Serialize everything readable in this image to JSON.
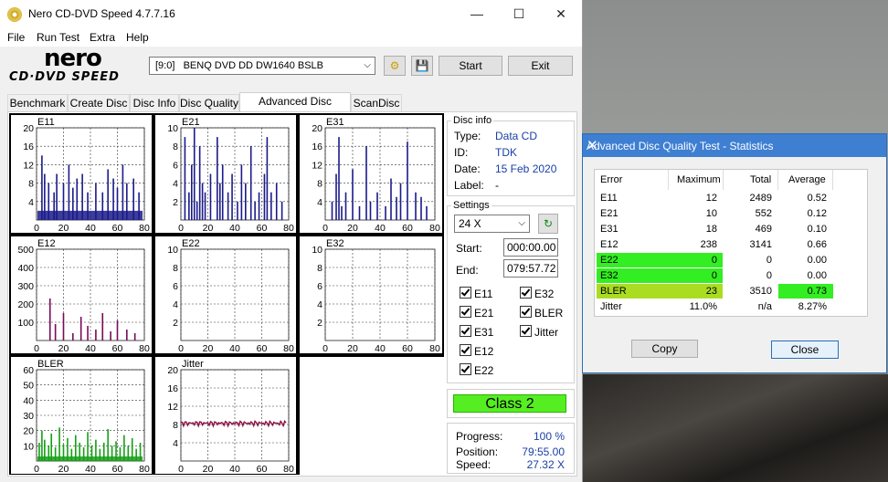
{
  "window": {
    "title": "Nero CD-DVD Speed 4.7.7.16"
  },
  "menu": [
    "File",
    "Run Test",
    "Extra",
    "Help"
  ],
  "logo": {
    "line1": "nero",
    "line2": "CD·DVD SPEED"
  },
  "toolbar": {
    "drive": "[9:0]   BENQ DVD DD DW1640 BSLB",
    "start_label": "Start",
    "exit_label": "Exit"
  },
  "tabs": [
    "Benchmark",
    "Create Disc",
    "Disc Info",
    "Disc Quality",
    "Advanced Disc Quality",
    "ScanDisc"
  ],
  "disc_info": {
    "title": "Disc info",
    "rows": [
      {
        "key": "Type:",
        "value": "Data CD"
      },
      {
        "key": "ID:",
        "value": "TDK"
      },
      {
        "key": "Date:",
        "value": "15 Feb 2020"
      },
      {
        "key": "Label:",
        "value": "-"
      }
    ]
  },
  "settings": {
    "title": "Settings",
    "speed": "24 X",
    "start_label": "Start:",
    "start_value": "000:00.00",
    "end_label": "End:",
    "end_value": "079:57.72",
    "checks_left": [
      "E11",
      "E21",
      "E31",
      "E12",
      "E22"
    ],
    "checks_right": [
      "E32",
      "BLER",
      "Jitter"
    ]
  },
  "class_label": "Class 2",
  "progress": {
    "rows": [
      {
        "key": "Progress:",
        "value": "100 %"
      },
      {
        "key": "Position:",
        "value": "79:55.00"
      },
      {
        "key": "Speed:",
        "value": "27.32 X"
      }
    ]
  },
  "colors": {
    "navy": "#1a1a8a",
    "purple": "#7a0a5a",
    "green": "#13a013",
    "jitter": "#8b1040",
    "class_green": "#55ee22"
  },
  "chart_data": [
    {
      "type": "bar",
      "title": "E11",
      "ylim": [
        0,
        20
      ],
      "yticks": [
        20,
        16,
        12,
        8,
        4
      ],
      "xticks": [
        0,
        20,
        40,
        60,
        80
      ],
      "color": "#1a1a8a",
      "baseline": 2,
      "spikes": [
        [
          4,
          14
        ],
        [
          6,
          10
        ],
        [
          9,
          8
        ],
        [
          13,
          6
        ],
        [
          15,
          10
        ],
        [
          20,
          8
        ],
        [
          24,
          12
        ],
        [
          27,
          7
        ],
        [
          30,
          9
        ],
        [
          34,
          10
        ],
        [
          38,
          6
        ],
        [
          44,
          8
        ],
        [
          49,
          6
        ],
        [
          53,
          11
        ],
        [
          57,
          9
        ],
        [
          60,
          7
        ],
        [
          64,
          12
        ],
        [
          67,
          8
        ],
        [
          72,
          9
        ],
        [
          76,
          6
        ]
      ]
    },
    {
      "type": "bar",
      "title": "E21",
      "ylim": [
        0,
        10
      ],
      "yticks": [
        10,
        8,
        6,
        4,
        2
      ],
      "xticks": [
        0,
        20,
        40,
        60,
        80
      ],
      "color": "#1a1a8a",
      "baseline": 0,
      "spikes": [
        [
          3,
          9
        ],
        [
          6,
          3
        ],
        [
          8,
          6
        ],
        [
          10,
          10
        ],
        [
          12,
          2
        ],
        [
          14,
          8
        ],
        [
          16,
          4
        ],
        [
          18,
          3
        ],
        [
          22,
          5
        ],
        [
          27,
          9
        ],
        [
          29,
          4
        ],
        [
          31,
          6
        ],
        [
          35,
          3
        ],
        [
          38,
          5
        ],
        [
          42,
          2
        ],
        [
          45,
          6
        ],
        [
          48,
          4
        ],
        [
          52,
          8
        ],
        [
          55,
          2
        ],
        [
          58,
          3
        ],
        [
          62,
          5
        ],
        [
          64,
          9
        ],
        [
          67,
          3
        ],
        [
          71,
          4
        ],
        [
          75,
          2
        ]
      ]
    },
    {
      "type": "bar",
      "title": "E31",
      "ylim": [
        0,
        20
      ],
      "yticks": [
        20,
        16,
        12,
        8,
        4
      ],
      "xticks": [
        0,
        20,
        40,
        60,
        80
      ],
      "color": "#1a1a8a",
      "baseline": 0,
      "spikes": [
        [
          5,
          4
        ],
        [
          8,
          10
        ],
        [
          10,
          18
        ],
        [
          12,
          3
        ],
        [
          15,
          6
        ],
        [
          20,
          11
        ],
        [
          25,
          3
        ],
        [
          30,
          16
        ],
        [
          33,
          4
        ],
        [
          38,
          6
        ],
        [
          44,
          3
        ],
        [
          48,
          9
        ],
        [
          52,
          5
        ],
        [
          55,
          8
        ],
        [
          60,
          17
        ],
        [
          66,
          6
        ],
        [
          70,
          5
        ],
        [
          74,
          3
        ]
      ]
    },
    {
      "type": "bar",
      "title": "E12",
      "ylim": [
        0,
        500
      ],
      "yticks": [
        500,
        400,
        300,
        200,
        100
      ],
      "xticks": [
        0,
        20,
        40,
        60,
        80
      ],
      "color": "#7a0a5a",
      "baseline": 0,
      "spikes": [
        [
          10,
          230
        ],
        [
          14,
          90
        ],
        [
          20,
          150
        ],
        [
          27,
          40
        ],
        [
          33,
          130
        ],
        [
          38,
          80
        ],
        [
          44,
          60
        ],
        [
          49,
          150
        ],
        [
          55,
          50
        ],
        [
          60,
          110
        ],
        [
          67,
          60
        ],
        [
          73,
          40
        ]
      ]
    },
    {
      "type": "bar",
      "title": "E22",
      "ylim": [
        0,
        10
      ],
      "yticks": [
        10,
        8,
        6,
        4,
        2
      ],
      "xticks": [
        0,
        20,
        40,
        60,
        80
      ],
      "color": "#7a0a5a",
      "baseline": 0,
      "spikes": []
    },
    {
      "type": "bar",
      "title": "E32",
      "ylim": [
        0,
        10
      ],
      "yticks": [
        10,
        8,
        6,
        4,
        2
      ],
      "xticks": [
        0,
        20,
        40,
        60,
        80
      ],
      "color": "#7a0a5a",
      "baseline": 0,
      "spikes": []
    },
    {
      "type": "bar",
      "title": "BLER",
      "ylim": [
        0,
        60
      ],
      "yticks": [
        60,
        50,
        40,
        30,
        20,
        10
      ],
      "xticks": [
        0,
        20,
        40,
        60,
        80
      ],
      "color": "#13a013",
      "baseline": 3,
      "spikes": [
        [
          2,
          12
        ],
        [
          4,
          20
        ],
        [
          6,
          14
        ],
        [
          9,
          10
        ],
        [
          11,
          18
        ],
        [
          14,
          9
        ],
        [
          17,
          22
        ],
        [
          20,
          11
        ],
        [
          23,
          15
        ],
        [
          26,
          8
        ],
        [
          29,
          17
        ],
        [
          32,
          12
        ],
        [
          35,
          9
        ],
        [
          38,
          19
        ],
        [
          41,
          10
        ],
        [
          44,
          14
        ],
        [
          47,
          8
        ],
        [
          50,
          12
        ],
        [
          53,
          21
        ],
        [
          56,
          10
        ],
        [
          59,
          13
        ],
        [
          62,
          9
        ],
        [
          65,
          17
        ],
        [
          68,
          10
        ],
        [
          71,
          15
        ],
        [
          74,
          8
        ],
        [
          77,
          12
        ]
      ]
    },
    {
      "type": "line",
      "title": "Jitter",
      "ylim": [
        0,
        20
      ],
      "yticks": [
        20,
        16,
        12,
        8,
        4
      ],
      "xticks": [
        0,
        20,
        40,
        60,
        80
      ],
      "color": "#8b1040",
      "level": 8.27
    }
  ],
  "statistics": {
    "title": "Advanced Disc Quality Test - Statistics",
    "headers": [
      "Error",
      "Maximum",
      "Total",
      "Average"
    ],
    "rows": [
      {
        "name": "E11",
        "max": "12",
        "total": "2489",
        "avg": "0.52"
      },
      {
        "name": "E21",
        "max": "10",
        "total": "552",
        "avg": "0.12"
      },
      {
        "name": "E31",
        "max": "18",
        "total": "469",
        "avg": "0.10"
      },
      {
        "name": "E12",
        "max": "238",
        "total": "3141",
        "avg": "0.66"
      },
      {
        "name": "E22",
        "max": "0",
        "total": "0",
        "avg": "0.00"
      },
      {
        "name": "E32",
        "max": "0",
        "total": "0",
        "avg": "0.00"
      },
      {
        "name": "BLER",
        "max": "23",
        "total": "3510",
        "avg": "0.73"
      },
      {
        "name": "Jitter",
        "max": "11.0%",
        "total": "n/a",
        "avg": "8.27%"
      }
    ],
    "copy_label": "Copy",
    "close_label": "Close"
  }
}
